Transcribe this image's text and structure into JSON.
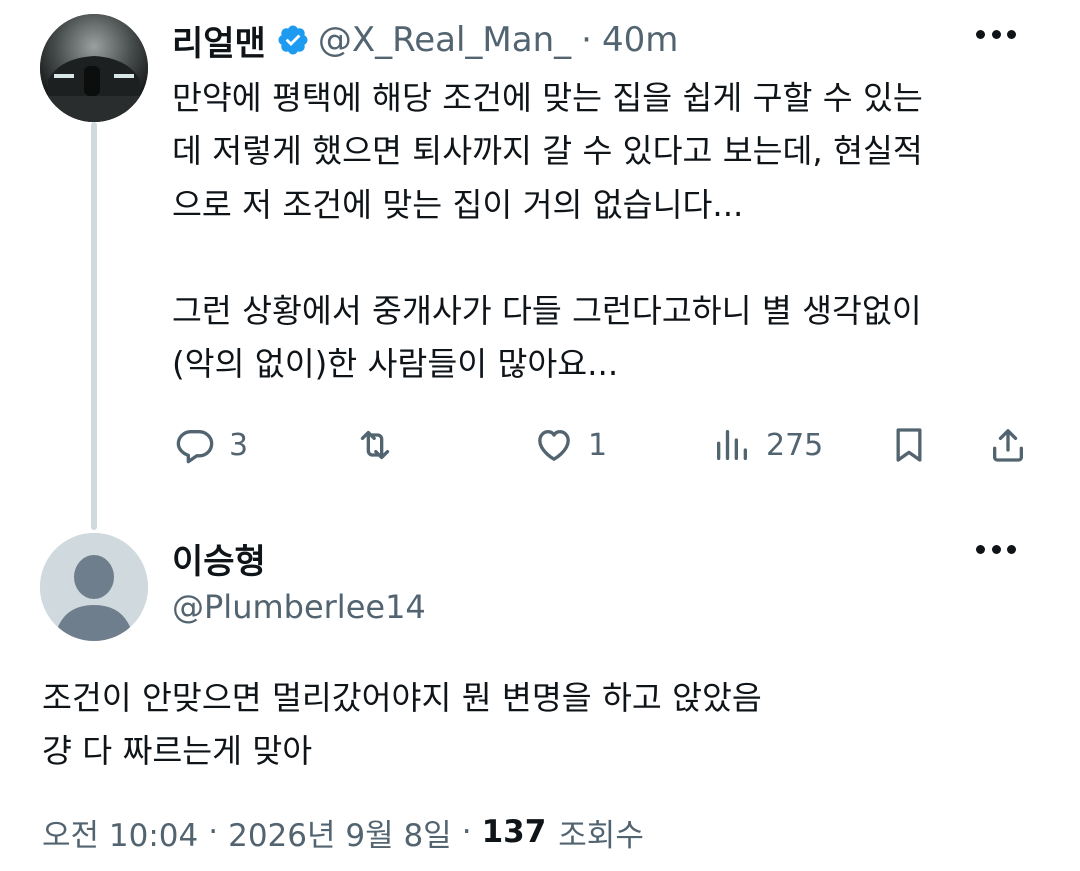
{
  "tweet": {
    "display_name": "리얼맨",
    "handle": "@X_Real_Man_",
    "separator": "·",
    "time": "40m",
    "lines": [
      "만약에 평택에 해당 조건에 맞는 집을 쉽게 구할 수 있는",
      "데 저렇게 했으면 퇴사까지 갈 수 있다고 보는데, 현실적",
      "으로 저 조건에 맞는 집이 거의 없습니다...",
      "",
      "그런 상황에서 중개사가 다들 그런다고하니 별 생각없이",
      "(악의 없이)한 사람들이 많아요..."
    ],
    "actions": {
      "reply_count": "3",
      "retweet_count": "",
      "like_count": "1",
      "view_count": "275"
    }
  },
  "reply": {
    "display_name": "이승형",
    "handle": "@Plumberlee14",
    "lines": [
      "조건이 안맞으면 멀리갔어야지 뭔 변명을 하고 앉았음",
      "걍 다 짜르는게 맞아"
    ],
    "meta": {
      "time": "오전 10:04",
      "separator": "·",
      "date": "2026년 9월 8일",
      "views_count": "137",
      "views_label": "조회수"
    }
  },
  "colors": {
    "text_primary": "#0f1419",
    "text_secondary": "#536471",
    "verified_blue": "#1d9bf0",
    "thread_line": "#cfd9de"
  },
  "icons": [
    "verified-badge-icon",
    "more-icon",
    "reply-icon",
    "retweet-icon",
    "like-icon",
    "views-icon",
    "bookmark-icon",
    "share-icon",
    "default-avatar-icon"
  ]
}
